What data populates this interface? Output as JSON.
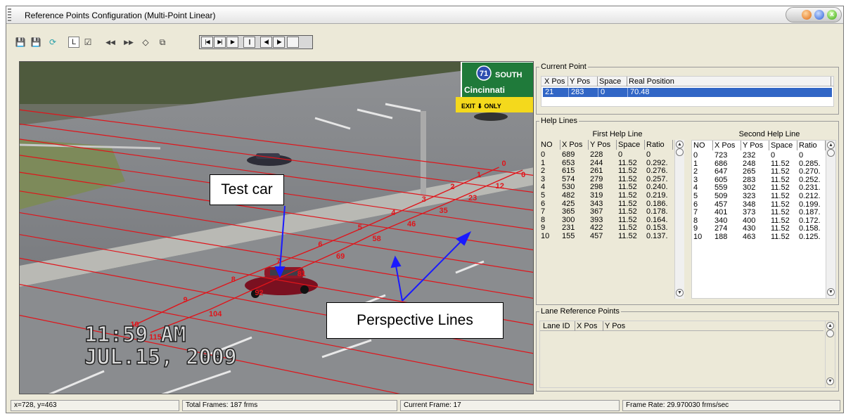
{
  "window": {
    "title": "Reference Points Configuration (Multi-Point Linear)",
    "close_glyph": "x"
  },
  "toolbar": {
    "icons": [
      "save-icon",
      "save-as-icon",
      "refresh-icon",
      "select-tool-icon",
      "checkbox-icon",
      "rewind-icon",
      "fast-forward-icon",
      "diamond-icon",
      "copy-icon"
    ],
    "glyphs": {
      "save": "💾",
      "save_as": "💾",
      "refresh": "⟳",
      "line_tool": "L",
      "check": "☑",
      "rewind": "◀◀",
      "fast_forward": "▶▶",
      "diamond": "◇",
      "copy": "⧉"
    },
    "player_buttons": [
      "|◀",
      "▶|",
      "▶",
      "||",
      "◀|",
      "|▶",
      ""
    ]
  },
  "video": {
    "timestamp_time": "11:59 AM",
    "timestamp_date": "JUL.15, 2009",
    "sign_route": "71",
    "sign_direction": "SOUTH",
    "sign_city": "Cincinnati",
    "sign_exit": "EXIT ⬇ ONLY",
    "callout_test_car": "Test car",
    "callout_perspective": "Perspective Lines",
    "marker_labels": [
      {
        "index": "0",
        "value": "0"
      },
      {
        "index": "1",
        "value": "12"
      },
      {
        "index": "2",
        "value": "23"
      },
      {
        "index": "3",
        "value": "35"
      },
      {
        "index": "4",
        "value": "46"
      },
      {
        "index": "5",
        "value": "58"
      },
      {
        "index": "6",
        "value": "69"
      },
      {
        "index": "7",
        "value": "81"
      },
      {
        "index": "8",
        "value": "92"
      },
      {
        "index": "9",
        "value": "104"
      },
      {
        "index": "10",
        "value": "115"
      }
    ]
  },
  "current_point": {
    "legend": "Current Point",
    "headers": [
      "X Pos",
      "Y Pos",
      "Space",
      "Real Position"
    ],
    "row": [
      "21",
      "283",
      "0",
      "70.48"
    ]
  },
  "help_lines": {
    "legend": "Help Lines",
    "first_title": "First Help Line",
    "second_title": "Second Help Line",
    "headers": [
      "NO",
      "X Pos",
      "Y Pos",
      "Space",
      "Ratio"
    ],
    "first_rows": [
      [
        "0",
        "689",
        "228",
        "0",
        "0"
      ],
      [
        "1",
        "653",
        "244",
        "11.52",
        "0.292."
      ],
      [
        "2",
        "615",
        "261",
        "11.52",
        "0.276."
      ],
      [
        "3",
        "574",
        "279",
        "11.52",
        "0.257."
      ],
      [
        "4",
        "530",
        "298",
        "11.52",
        "0.240."
      ],
      [
        "5",
        "482",
        "319",
        "11.52",
        "0.219."
      ],
      [
        "6",
        "425",
        "343",
        "11.52",
        "0.186."
      ],
      [
        "7",
        "365",
        "367",
        "11.52",
        "0.178."
      ],
      [
        "8",
        "300",
        "393",
        "11.52",
        "0.164."
      ],
      [
        "9",
        "231",
        "422",
        "11.52",
        "0.153."
      ],
      [
        "10",
        "155",
        "457",
        "11.52",
        "0.137."
      ]
    ],
    "second_rows": [
      [
        "0",
        "723",
        "232",
        "0",
        "0"
      ],
      [
        "1",
        "686",
        "248",
        "11.52",
        "0.285."
      ],
      [
        "2",
        "647",
        "265",
        "11.52",
        "0.270."
      ],
      [
        "3",
        "605",
        "283",
        "11.52",
        "0.252."
      ],
      [
        "4",
        "559",
        "302",
        "11.52",
        "0.231."
      ],
      [
        "5",
        "509",
        "323",
        "11.52",
        "0.212."
      ],
      [
        "6",
        "457",
        "348",
        "11.52",
        "0.199."
      ],
      [
        "7",
        "401",
        "373",
        "11.52",
        "0.187."
      ],
      [
        "8",
        "340",
        "400",
        "11.52",
        "0.172."
      ],
      [
        "9",
        "274",
        "430",
        "11.52",
        "0.158."
      ],
      [
        "10",
        "188",
        "463",
        "11.52",
        "0.125."
      ]
    ]
  },
  "lane_reference": {
    "legend": "Lane Reference Points",
    "headers": [
      "Lane ID",
      "X Pos",
      "Y Pos"
    ]
  },
  "status": {
    "coords": "x=728, y=463",
    "total_frames": "Total Frames: 187 frms",
    "current_frame": "Current Frame: 17",
    "frame_rate": "Frame Rate:  29.970030 frms/sec"
  },
  "colors": {
    "accent_selection": "#3166c6",
    "overlay_lines": "#e0141a",
    "arrow": "#1a1aff"
  }
}
